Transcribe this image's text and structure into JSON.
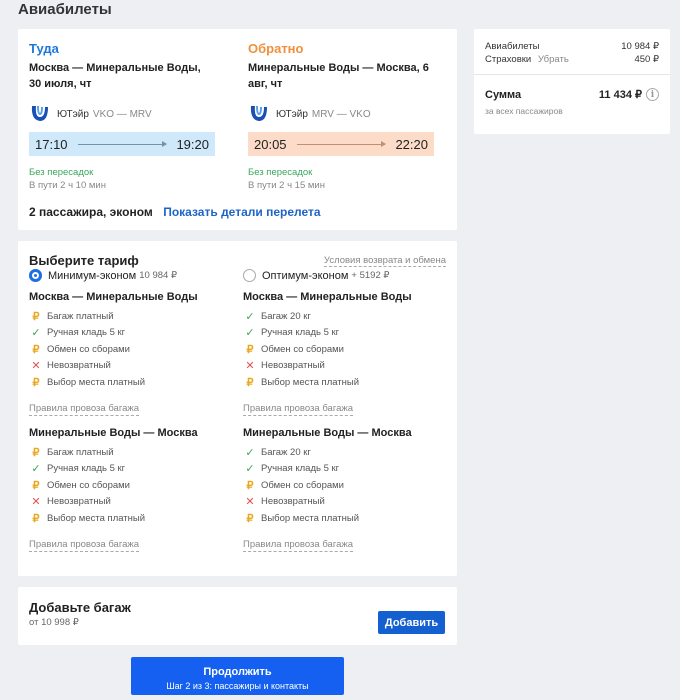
{
  "page": {
    "title": "Авиабилеты"
  },
  "flights": {
    "outbound": {
      "label": "Туда",
      "route": "Москва — Минеральные Воды, 30 июля, чт",
      "airline": "ЮТэйр",
      "codes": "VKO — MRV",
      "depart": "17:10",
      "arrive": "19:20",
      "transfers": "Без пересадок",
      "duration": "В пути 2 ч 10 мин"
    },
    "return": {
      "label": "Обратно",
      "route": "Минеральные Воды — Москва, 6 авг, чт",
      "airline": "ЮТэйр",
      "codes": "MRV — VKO",
      "depart": "20:05",
      "arrive": "22:20",
      "transfers": "Без пересадок",
      "duration": "В пути 2 ч 15 мин"
    },
    "passengers": "2 пассажира, эконом",
    "details_link": "Показать детали перелета"
  },
  "tariff": {
    "title": "Выберите тариф",
    "conditions_link": "Условия возврата и обмена",
    "options": [
      {
        "name": "Минимум-эконом",
        "price": "10 984 ₽",
        "selected": true,
        "segments": [
          {
            "route": "Москва — Минеральные Воды",
            "features": [
              {
                "icon": "coin-icon",
                "text": "Багаж платный"
              },
              {
                "icon": "check-icon",
                "text": "Ручная кладь 5 кг"
              },
              {
                "icon": "coin-icon",
                "text": "Обмен со сборами"
              },
              {
                "icon": "cross-icon",
                "text": "Невозвратный"
              },
              {
                "icon": "coin-icon",
                "text": "Выбор места платный"
              }
            ],
            "rules": "Правила провоза багажа"
          },
          {
            "route": "Минеральные Воды — Москва",
            "features": [
              {
                "icon": "coin-icon",
                "text": "Багаж платный"
              },
              {
                "icon": "check-icon",
                "text": "Ручная кладь 5 кг"
              },
              {
                "icon": "coin-icon",
                "text": "Обмен со сборами"
              },
              {
                "icon": "cross-icon",
                "text": "Невозвратный"
              },
              {
                "icon": "coin-icon",
                "text": "Выбор места платный"
              }
            ],
            "rules": "Правила провоза багажа"
          }
        ]
      },
      {
        "name": "Оптимум-эконом",
        "price": "+ 5192 ₽",
        "selected": false,
        "segments": [
          {
            "route": "Москва — Минеральные Воды",
            "features": [
              {
                "icon": "check-icon",
                "text": "Багаж 20 кг"
              },
              {
                "icon": "check-icon",
                "text": "Ручная кладь 5 кг"
              },
              {
                "icon": "coin-icon",
                "text": "Обмен со сборами"
              },
              {
                "icon": "cross-icon",
                "text": "Невозвратный"
              },
              {
                "icon": "coin-icon",
                "text": "Выбор места платный"
              }
            ],
            "rules": "Правила провоза багажа"
          },
          {
            "route": "Минеральные Воды — Москва",
            "features": [
              {
                "icon": "check-icon",
                "text": "Багаж 20 кг"
              },
              {
                "icon": "check-icon",
                "text": "Ручная кладь 5 кг"
              },
              {
                "icon": "coin-icon",
                "text": "Обмен со сборами"
              },
              {
                "icon": "cross-icon",
                "text": "Невозвратный"
              },
              {
                "icon": "coin-icon",
                "text": "Выбор места платный"
              }
            ],
            "rules": "Правила провоза багажа"
          }
        ]
      }
    ]
  },
  "baggage": {
    "title": "Добавьте багаж",
    "price": "от 10 998 ₽",
    "button": "Добавить"
  },
  "summary": {
    "tickets_label": "Авиабилеты",
    "tickets_value": "10 984 ₽",
    "insurance_label": "Страховки",
    "insurance_remove": "Убрать",
    "insurance_value": "450 ₽",
    "total_label": "Сумма",
    "total_value": "11 434 ₽",
    "total_sub": "за всех пассажиров",
    "info_icon": "i"
  },
  "continue": {
    "label": "Продолжить",
    "step": "Шаг 2 из 3: пассажиры и контакты"
  },
  "colors": {
    "accent": "#1560d0",
    "outbound": "#1e78dc",
    "return": "#f0903c",
    "ok": "#3aa65c",
    "paid": "#e8a820",
    "no": "#e05050"
  }
}
